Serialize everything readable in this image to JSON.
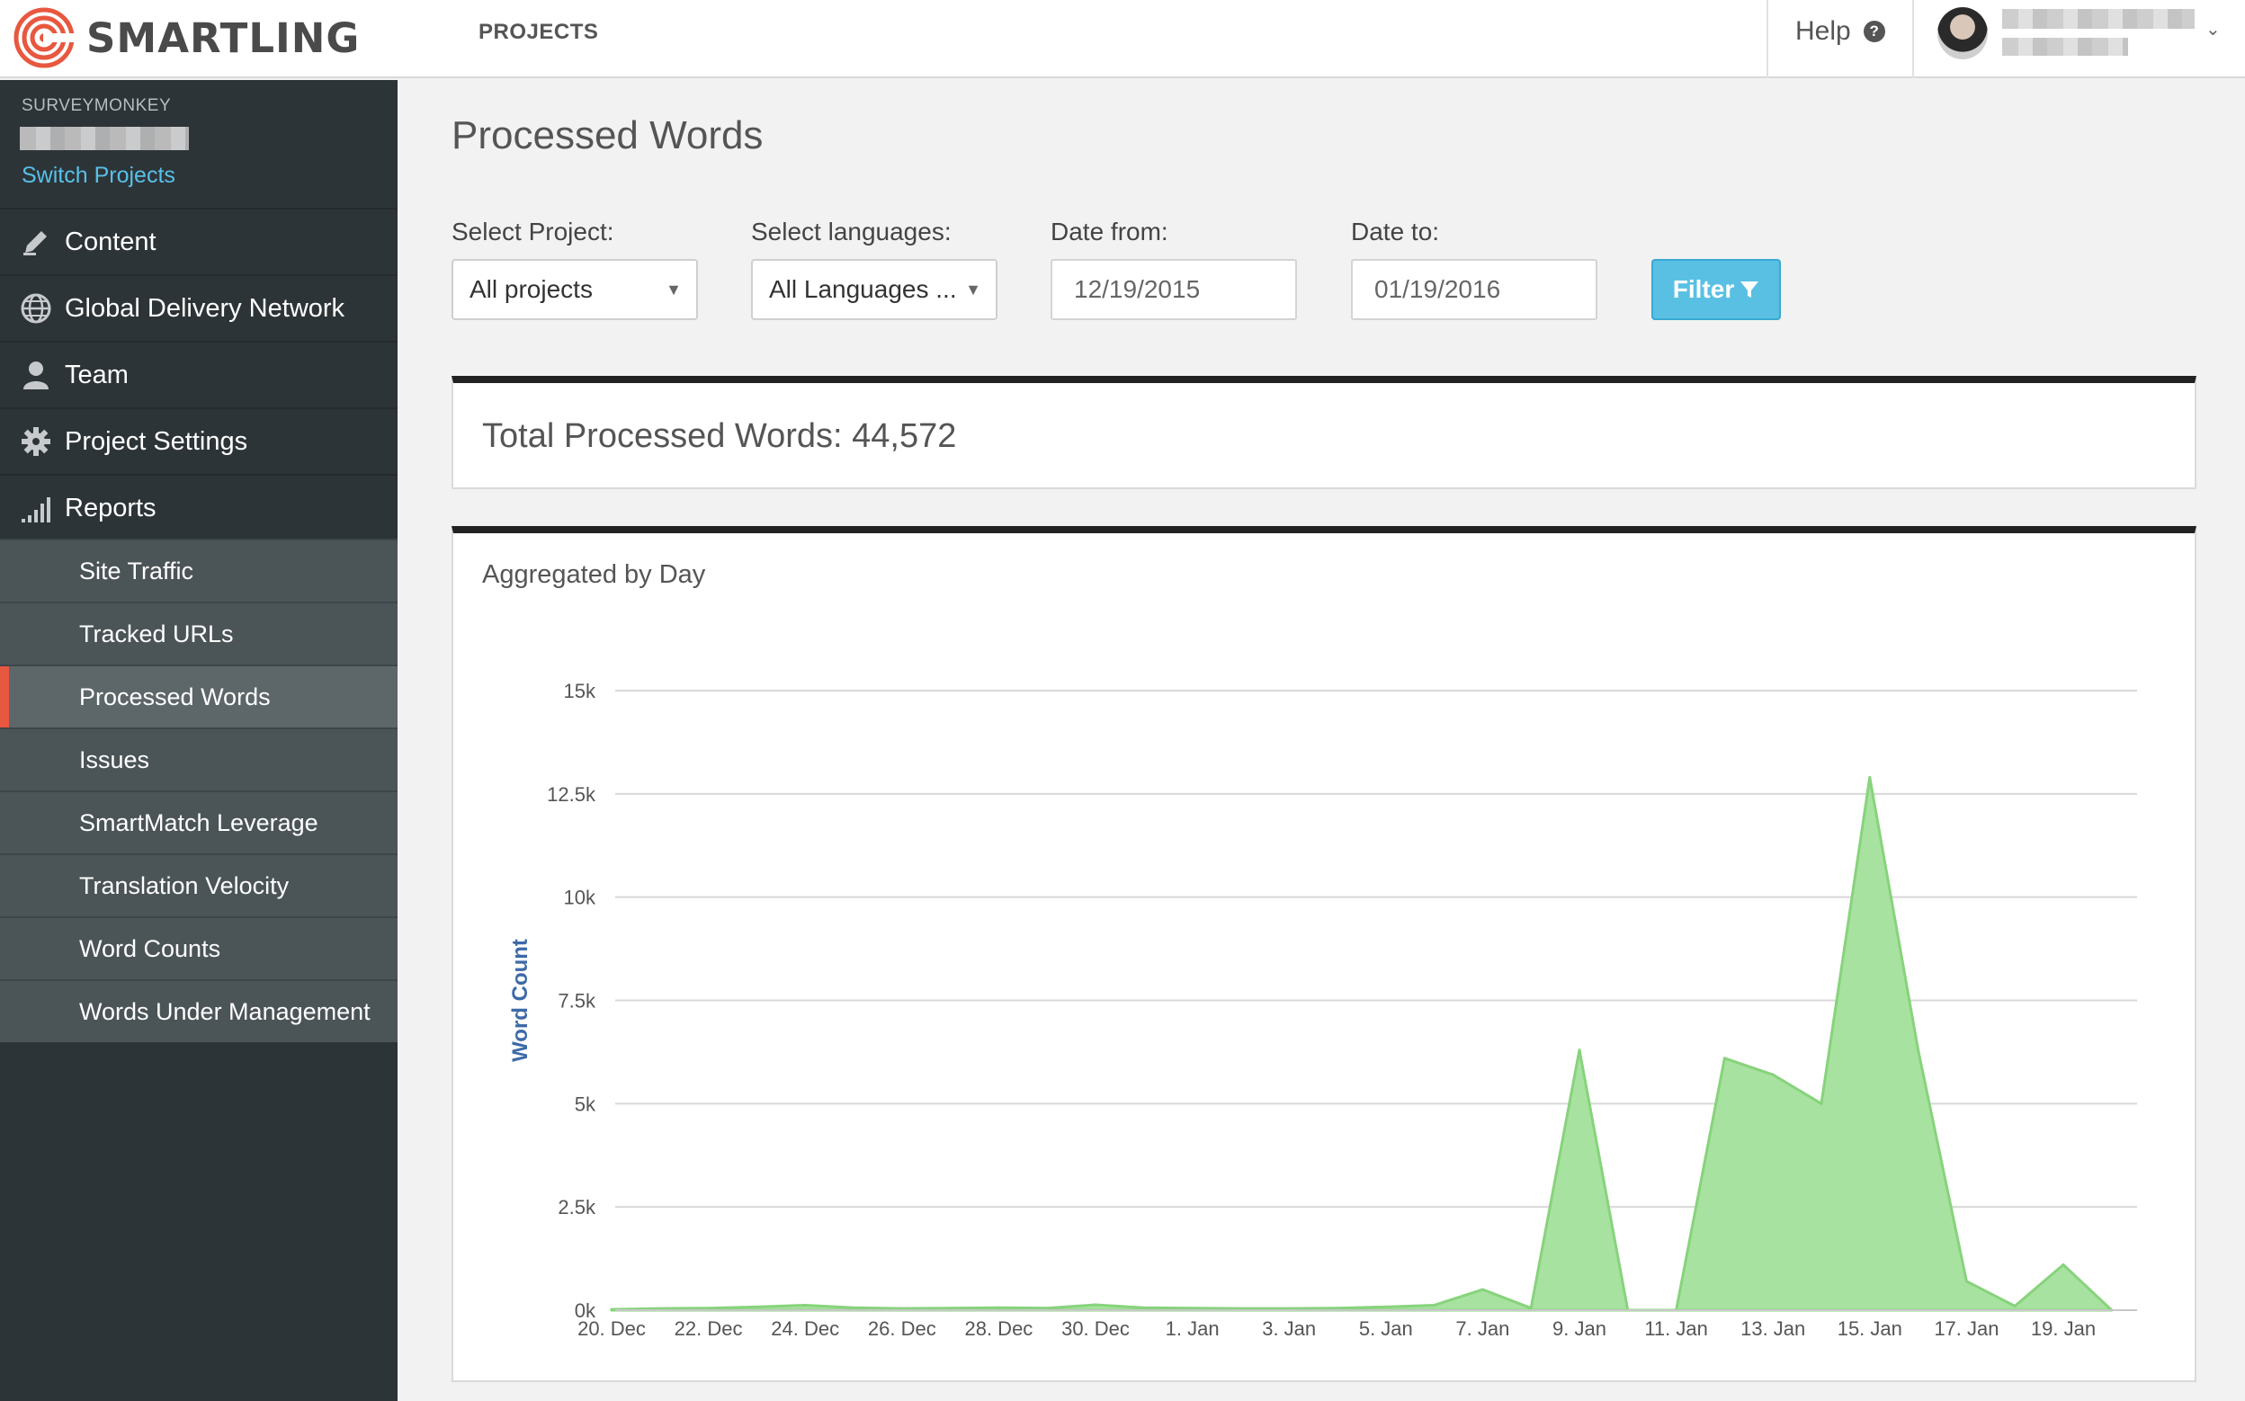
{
  "header": {
    "brand": "SMARTLING",
    "nav_projects": "PROJECTS",
    "help_label": "Help",
    "help_icon": "question-circle-icon"
  },
  "sidebar": {
    "org_name": "SURVEYMONKEY",
    "switch_projects": "Switch Projects",
    "items": [
      {
        "label": "Content",
        "icon": "pencil-icon"
      },
      {
        "label": "Global Delivery Network",
        "icon": "globe-icon"
      },
      {
        "label": "Team",
        "icon": "user-icon"
      },
      {
        "label": "Project Settings",
        "icon": "gear-icon"
      },
      {
        "label": "Reports",
        "icon": "bar-signal-icon"
      }
    ],
    "sub_items": [
      {
        "label": "Site Traffic"
      },
      {
        "label": "Tracked URLs"
      },
      {
        "label": "Processed Words",
        "active": true
      },
      {
        "label": "Issues"
      },
      {
        "label": "SmartMatch Leverage"
      },
      {
        "label": "Translation Velocity"
      },
      {
        "label": "Word Counts"
      },
      {
        "label": "Words Under Management"
      }
    ]
  },
  "main": {
    "title": "Processed Words",
    "filters": {
      "project_label": "Select Project:",
      "project_value": "All projects",
      "languages_label": "Select languages:",
      "languages_value": "All Languages ...",
      "date_from_label": "Date from:",
      "date_from_value": "12/19/2015",
      "date_to_label": "Date to:",
      "date_to_value": "01/19/2016",
      "filter_button": "Filter"
    },
    "total_text": "Total Processed Words: 44,572",
    "chart_title": "Aggregated by Day"
  },
  "colors": {
    "accent": "#59c0e3",
    "active_marker": "#e8573f",
    "area_fill": "#a8e2a0",
    "area_stroke": "#87d37c",
    "axis_label": "#3d6aa8"
  },
  "chart_data": {
    "type": "area",
    "title": "Aggregated by Day",
    "ylabel": "Word Count",
    "xlabel": "",
    "ylim": [
      0,
      15000
    ],
    "yticks": [
      0,
      2500,
      5000,
      7500,
      10000,
      12500,
      15000
    ],
    "ytick_labels": [
      "0k",
      "2.5k",
      "5k",
      "7.5k",
      "10k",
      "12.5k",
      "15k"
    ],
    "x_tick_labels": [
      "20. Dec",
      "22. Dec",
      "24. Dec",
      "26. Dec",
      "28. Dec",
      "30. Dec",
      "1. Jan",
      "3. Jan",
      "5. Jan",
      "7. Jan",
      "9. Jan",
      "11. Jan",
      "13. Jan",
      "15. Jan",
      "17. Jan",
      "19. Jan"
    ],
    "categories": [
      "20. Dec",
      "21. Dec",
      "22. Dec",
      "23. Dec",
      "24. Dec",
      "25. Dec",
      "26. Dec",
      "27. Dec",
      "28. Dec",
      "29. Dec",
      "30. Dec",
      "31. Dec",
      "1. Jan",
      "2. Jan",
      "3. Jan",
      "4. Jan",
      "5. Jan",
      "6. Jan",
      "7. Jan",
      "8. Jan",
      "9. Jan",
      "10. Jan",
      "11. Jan",
      "12. Jan",
      "13. Jan",
      "14. Jan",
      "15. Jan",
      "16. Jan",
      "17. Jan",
      "18. Jan",
      "19. Jan",
      "20. Jan"
    ],
    "series": [
      {
        "values": [
          20,
          40,
          50,
          80,
          120,
          60,
          40,
          50,
          60,
          50,
          130,
          60,
          50,
          40,
          40,
          50,
          80,
          120,
          500,
          50,
          6300,
          0,
          0,
          6100,
          5700,
          5000,
          12900,
          6300,
          700,
          100,
          1100,
          0
        ]
      }
    ]
  }
}
